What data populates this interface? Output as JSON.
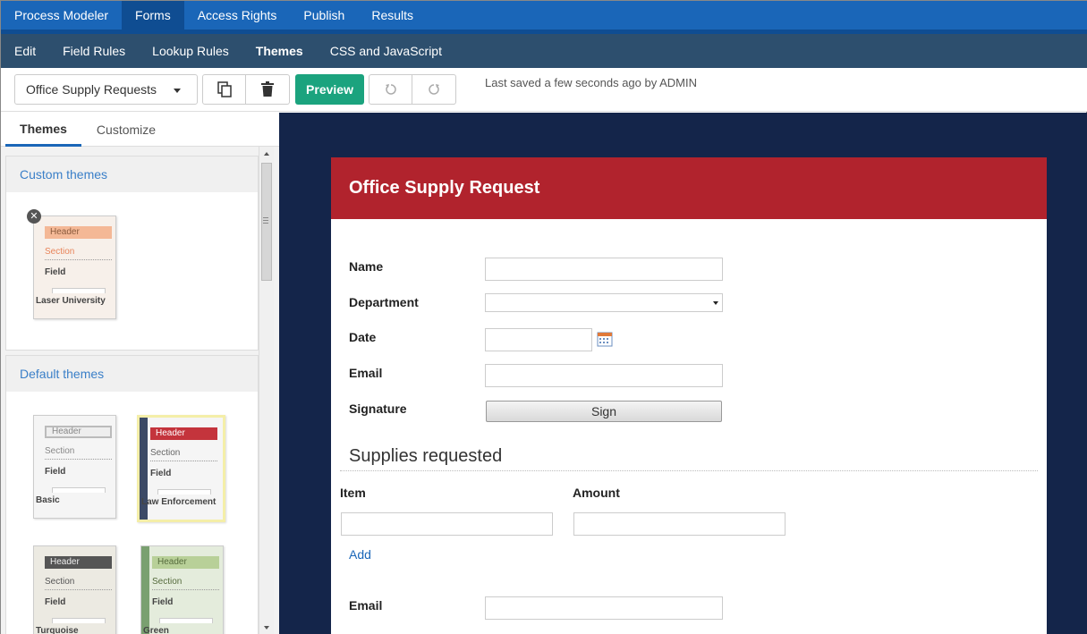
{
  "top_nav": {
    "items": [
      "Process Modeler",
      "Forms",
      "Access Rights",
      "Publish",
      "Results"
    ],
    "active_index": 1
  },
  "sub_nav": {
    "items": [
      "Edit",
      "Field Rules",
      "Lookup Rules",
      "Themes",
      "CSS and JavaScript"
    ],
    "active_index": 3
  },
  "toolbar": {
    "form_select": "Office Supply Requests",
    "preview_label": "Preview",
    "last_saved": "Last saved a few seconds ago by ADMIN",
    "icons": [
      "copy-icon",
      "trash-icon",
      "undo-icon",
      "redo-icon"
    ]
  },
  "left_panel": {
    "tabs": [
      "Themes",
      "Customize"
    ],
    "active_tab": 0,
    "custom_section": {
      "title": "Custom themes",
      "themes": [
        {
          "header": "Header",
          "section": "Section",
          "field": "Field",
          "name": "Laser University"
        }
      ]
    },
    "default_section": {
      "title": "Default themes",
      "themes": [
        {
          "header": "Header",
          "section": "Section",
          "field": "Field",
          "name": "Basic"
        },
        {
          "header": "Header",
          "section": "Section",
          "field": "Field",
          "name": "Law Enforcement"
        },
        {
          "header": "Header",
          "section": "Section",
          "field": "Field",
          "name": "Turquoise"
        },
        {
          "header": "Header",
          "section": "Section",
          "field": "Field",
          "name": "Green"
        }
      ]
    }
  },
  "form": {
    "title": "Office Supply Request",
    "fields": {
      "name": "Name",
      "department": "Department",
      "date": "Date",
      "email": "Email",
      "signature": "Signature",
      "sign_button": "Sign"
    },
    "supplies": {
      "title": "Supplies requested",
      "col_item": "Item",
      "col_amount": "Amount",
      "add_link": "Add"
    },
    "email2": "Email"
  },
  "colors": {
    "top_nav": "#1a66b8",
    "sub_nav": "#2d4f6e",
    "preview": "#1ba37e",
    "form_header": "#b1232d",
    "canvas_bg": "#14254a"
  }
}
